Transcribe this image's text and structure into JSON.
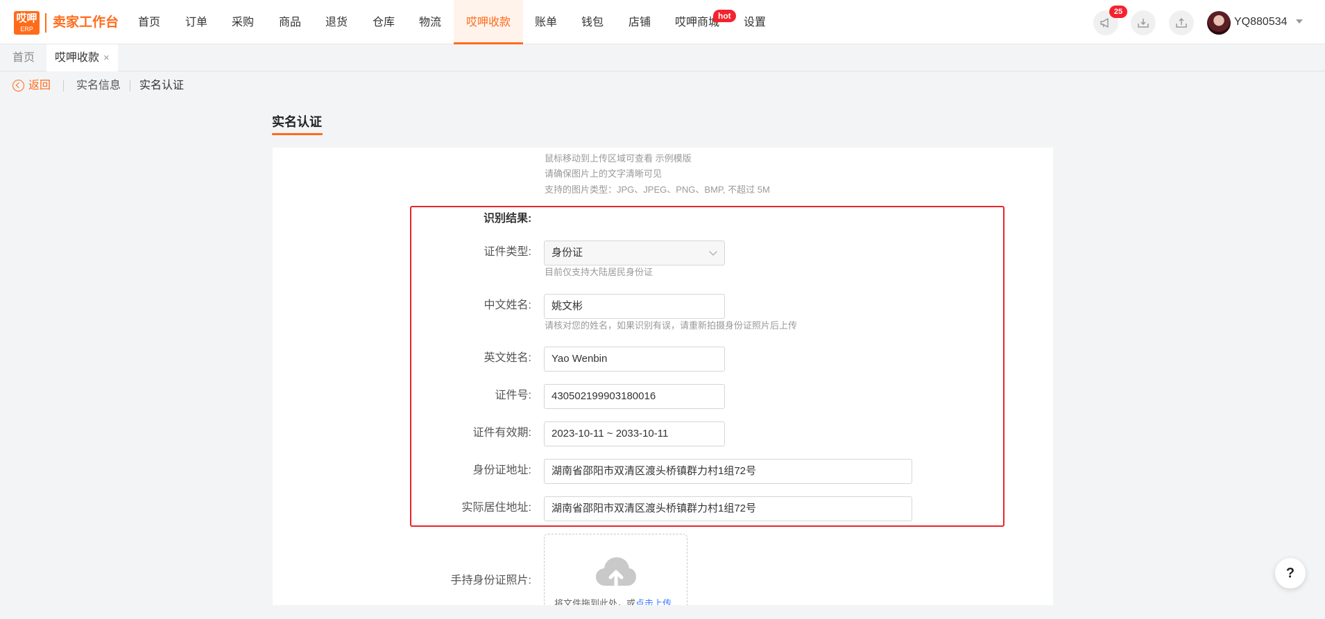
{
  "brand": {
    "logo_line1": "哎呷",
    "logo_line2": "ERP",
    "title": "卖家工作台",
    "accent": "#ff6b1a"
  },
  "nav": {
    "items": [
      {
        "label": "首页"
      },
      {
        "label": "订单"
      },
      {
        "label": "采购"
      },
      {
        "label": "商品"
      },
      {
        "label": "退货"
      },
      {
        "label": "仓库"
      },
      {
        "label": "物流"
      },
      {
        "label": "哎呷收款"
      },
      {
        "label": "账单"
      },
      {
        "label": "钱包"
      },
      {
        "label": "店铺"
      },
      {
        "label": "哎呷商城"
      },
      {
        "label": "设置"
      }
    ],
    "active": "哎呷收款",
    "hot_badge": "hot"
  },
  "header": {
    "notification_count": "25",
    "username": "YQ880534",
    "icons": [
      "megaphone-icon",
      "download-icon",
      "upload-icon"
    ]
  },
  "tabs": [
    {
      "label": "首页"
    },
    {
      "label": "哎呷收款",
      "close": "×"
    }
  ],
  "breadcrumb": {
    "back": "返回",
    "items": [
      "实名信息",
      "实名认证"
    ]
  },
  "section_title": "实名认证",
  "upload_hints": [
    "鼠标移动到上传区域可查看 示例模版",
    "请确保图片上的文字清晰可见",
    "支持的图片类型：JPG、JPEG、PNG、BMP, 不超过 5M"
  ],
  "recognition": {
    "title": "识别结果:",
    "id_type": {
      "label": "证件类型:",
      "value": "身份证",
      "hint": "目前仅支持大陆居民身份证"
    },
    "chinese_name": {
      "label": "中文姓名:",
      "value": "姚文彬",
      "hint": "请核对您的姓名，如果识别有误，请重新拍摄身份证照片后上传"
    },
    "english_name": {
      "label": "英文姓名:",
      "value": "Yao Wenbin"
    },
    "id_number": {
      "label": "证件号:",
      "value": "430502199903180016"
    },
    "validity": {
      "label": "证件有效期:",
      "value": "2023-10-11 ~ 2033-10-11"
    },
    "id_address": {
      "label": "身份证地址:",
      "value": "湖南省邵阳市双清区渡头桥镇群力村1组72号"
    },
    "residence_address": {
      "label": "实际居住地址:",
      "value": "湖南省邵阳市双清区渡头桥镇群力村1组72号"
    }
  },
  "handheld_photo": {
    "label": "手持身份证照片:",
    "upload_text": "将文件拖到此处，或",
    "upload_link": "点击上传"
  },
  "help": "?"
}
